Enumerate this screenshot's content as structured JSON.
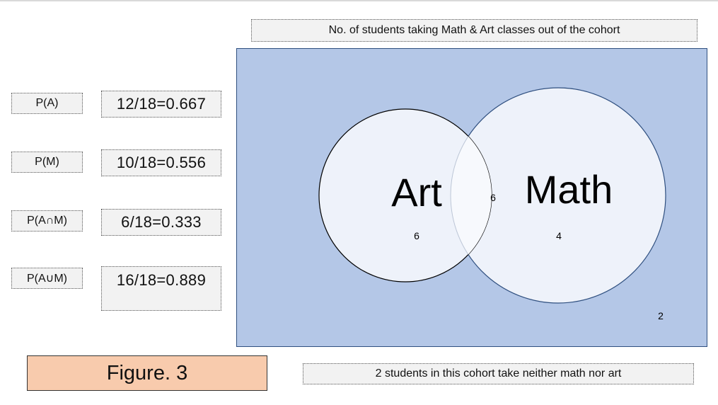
{
  "title": "No. of students taking Math & Art classes out of the cohort",
  "probabilities": [
    {
      "label": "P(A)",
      "value": "12/18=0.667"
    },
    {
      "label": "P(M)",
      "value": "10/18=0.556"
    },
    {
      "label": "P(A∩M)",
      "value": "6/18=0.333"
    },
    {
      "label": "P(A∪M)",
      "value": "16/18=0.889"
    }
  ],
  "venn": {
    "art_label": "Art",
    "math_label": "Math",
    "art_only": "6",
    "intersection": "6",
    "math_only": "4",
    "neither": "2",
    "colors": {
      "universe": "#b4c7e7",
      "circle_fill": "#eef2fa",
      "art_stroke": "#000000",
      "math_stroke": "#2f4f7f"
    }
  },
  "caption": "2 students in this cohort take neither math nor art",
  "figure_label": "Figure. 3"
}
